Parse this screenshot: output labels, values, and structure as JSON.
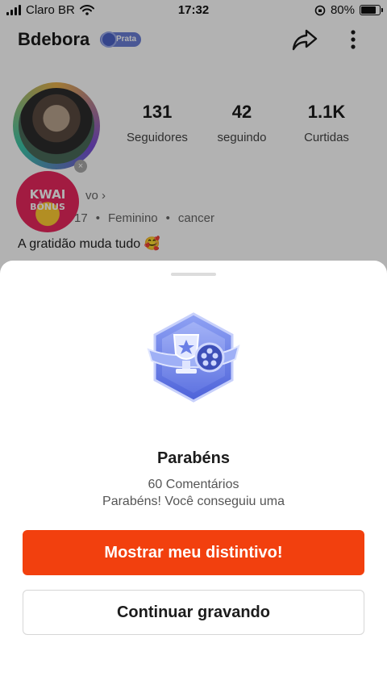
{
  "status_bar": {
    "carrier": "Claro BR",
    "time": "17:32",
    "battery": "80%",
    "battery_level": 0.8
  },
  "profile": {
    "username": "Bdebora",
    "level_badge": "Prata",
    "stats": [
      {
        "value": "131",
        "label": "Seguidores"
      },
      {
        "value": "42",
        "label": "seguindo"
      },
      {
        "value": "1.1K",
        "label": "Curtidas"
      }
    ],
    "kwai_bonus": {
      "line1": "KWAI",
      "line2": "BÔNUS"
    },
    "info_partial": "vo",
    "meta": {
      "date_partial": "17",
      "gender": "Feminino",
      "sign": "cancer"
    },
    "bio": "A gratidão muda tudo 🥰"
  },
  "sheet": {
    "title": "Parabéns",
    "line1": "60 Comentários",
    "line2": "Parabéns! Você conseguiu uma",
    "primary_button": "Mostrar meu distintivo!",
    "secondary_button": "Continuar gravando"
  },
  "icons": {
    "share": "share-arrow-icon",
    "more": "more-vertical-icon",
    "badge": "trophy-film-badge-icon"
  },
  "colors": {
    "accent": "#f2400e",
    "badge_blue": "#6a7fd6"
  }
}
